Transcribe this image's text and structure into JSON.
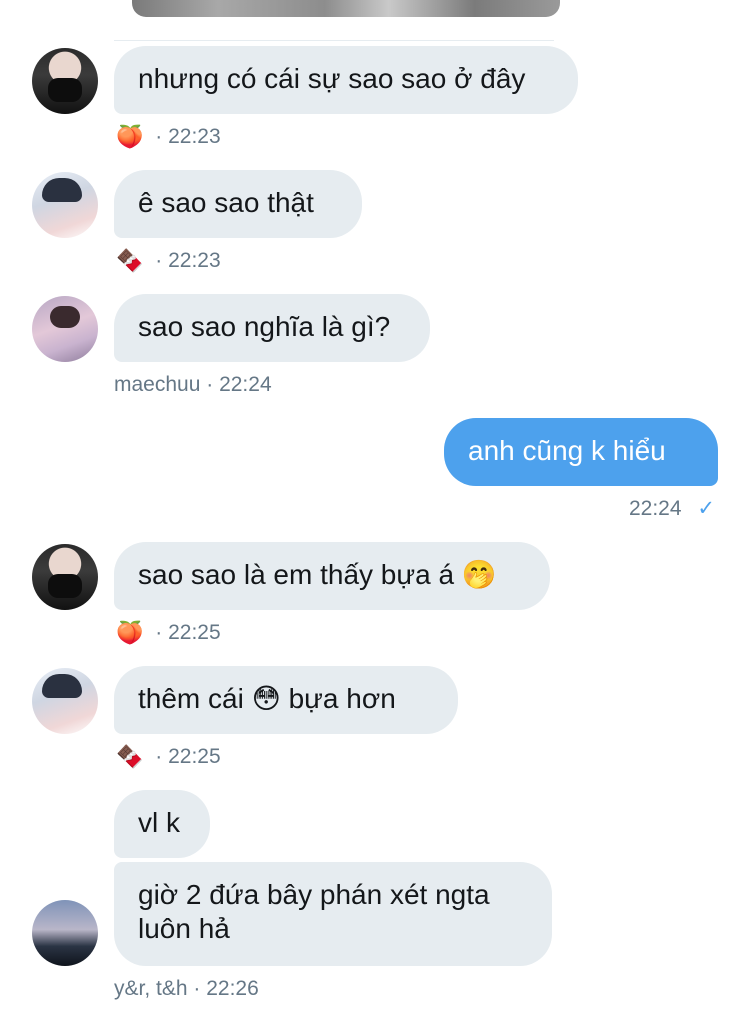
{
  "messages": [
    {
      "text": "nhưng có cái sự sao sao ở đây",
      "meta_emoji": "🍑",
      "meta_sep": "·",
      "time": "22:23",
      "avatar": "masked-user-avatar"
    },
    {
      "text": "ê sao sao thật",
      "meta_emoji": "🍫",
      "meta_sep": "·",
      "time": "22:23",
      "avatar": "dark-hair-user-avatar"
    },
    {
      "text": "sao sao nghĩa là gì?",
      "meta_name": "maechuu",
      "meta_sep": "·",
      "time": "22:24",
      "avatar": "pink-jacket-user-avatar"
    },
    {
      "text": "anh cũng k hiểu",
      "time": "22:24",
      "status": "✓",
      "sent": true
    },
    {
      "text": "sao sao là em thấy bựa á",
      "text_emoji": "🤭",
      "meta_emoji": "🍑",
      "meta_sep": "·",
      "time": "22:25",
      "avatar": "masked-user-avatar"
    },
    {
      "text_before": "thêm cái",
      "text_emoji": "😳",
      "text_after": "bựa hơn",
      "meta_emoji": "🍫",
      "meta_sep": "·",
      "time": "22:25",
      "avatar": "dark-hair-user-avatar"
    },
    {
      "text": "vl k"
    },
    {
      "text": "giờ 2 đứa bây phán xét ngta luôn hả",
      "meta_name": "y&r, t&h",
      "meta_sep": "·",
      "time": "22:26",
      "avatar": "sky-photo-user-avatar"
    }
  ],
  "colors": {
    "received_bubble": "#e6ecf0",
    "sent_bubble": "#4da1ed",
    "meta_text": "#657786"
  }
}
